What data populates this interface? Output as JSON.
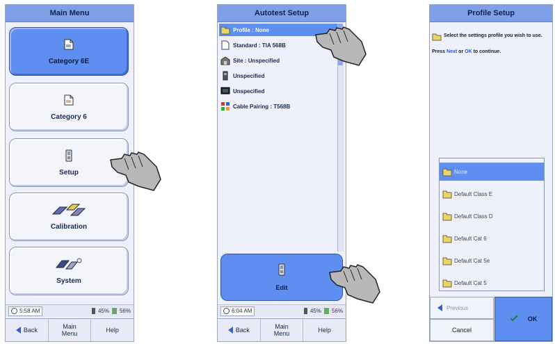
{
  "panel1": {
    "title": "Main Menu",
    "buttons": [
      {
        "label": "Category 6E",
        "icon": "document-icon"
      },
      {
        "label": "Category 6",
        "icon": "document-icon"
      },
      {
        "label": "Setup",
        "icon": "setup-device-icon"
      },
      {
        "label": "Calibration",
        "icon": "calibration-icon"
      },
      {
        "label": "System",
        "icon": "system-icon"
      }
    ],
    "status": {
      "time": "5:58 AM",
      "battery_left": "45%",
      "battery_right": "56%"
    },
    "bottom": {
      "back": "Back",
      "main": "Main Menu",
      "help": "Help"
    }
  },
  "panel2": {
    "title": "Autotest Setup",
    "rows": [
      {
        "label": "Profile : None",
        "icon": "folder-icon"
      },
      {
        "label": "Standard : TIA 568B",
        "icon": "document-icon"
      },
      {
        "label": "Site : Unspecified",
        "icon": "site-icon"
      },
      {
        "label": "Unspecified",
        "icon": "cable-icon"
      },
      {
        "label": "Unspecified",
        "icon": "monitor-icon"
      },
      {
        "label": "Cable Pairing : T568B",
        "icon": "pairing-icon"
      }
    ],
    "edit_label": "Edit",
    "status": {
      "time": "6:04 AM",
      "battery_left": "45%",
      "battery_right": "56%"
    },
    "bottom": {
      "back": "Back",
      "main": "Main Menu",
      "help": "Help"
    }
  },
  "panel3": {
    "title": "Profile Setup",
    "instruction": "Select the settings profile you wish to use.",
    "press_prefix": "Press",
    "press_next": "Next",
    "press_or": "or",
    "press_ok": "OK",
    "press_suffix": "to continue.",
    "profiles": [
      "None",
      "Default Class E",
      "Default Class D",
      "Default Cat 6",
      "Default Cat 5e",
      "Default Cat 5"
    ],
    "previous_label": "Previous",
    "cancel_label": "Cancel",
    "ok_label": "OK"
  },
  "colors": {
    "accent": "#5e8ff0",
    "title": "#7fa0e8",
    "panel": "#eef0fb"
  }
}
